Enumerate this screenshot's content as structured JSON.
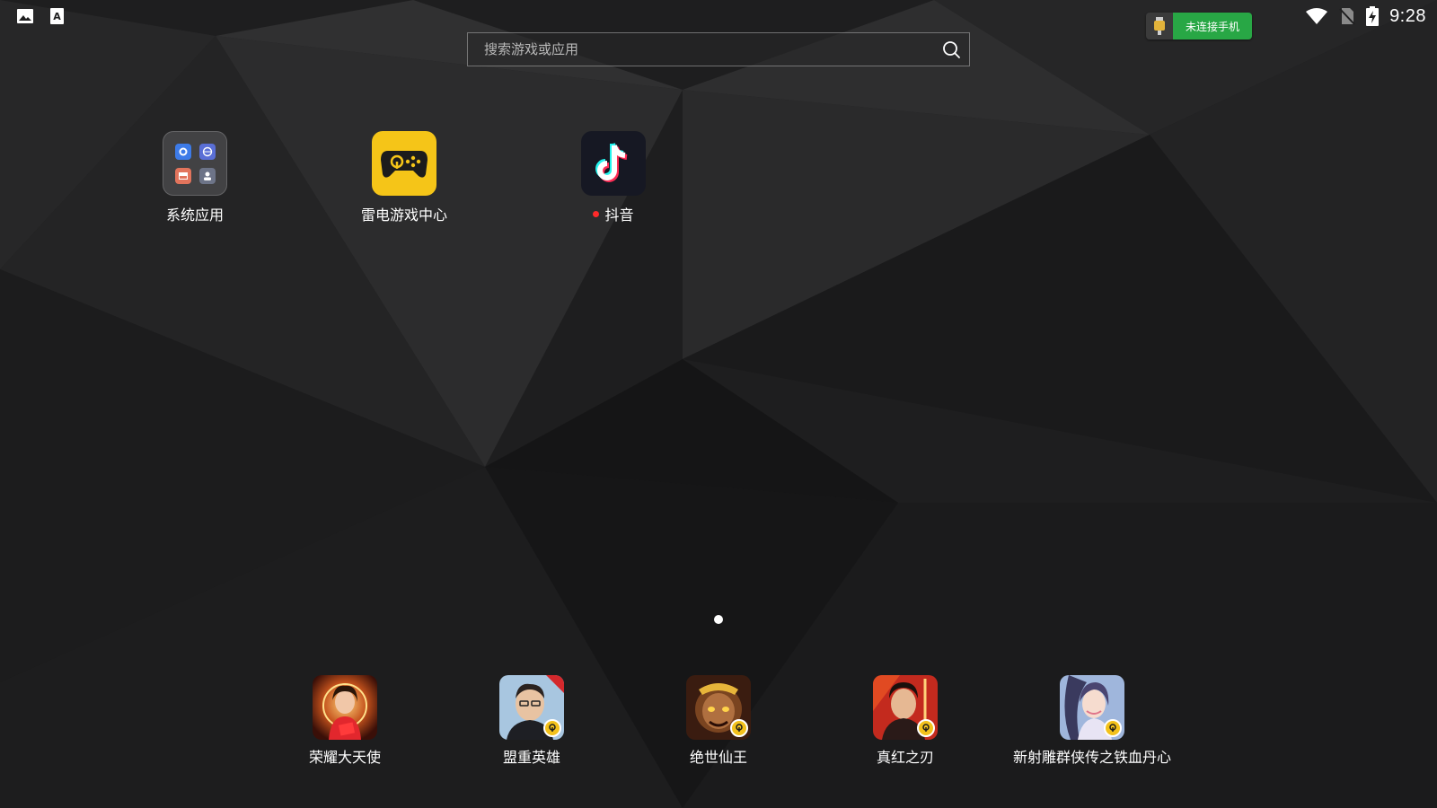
{
  "status_bar": {
    "left_icons": [
      "image-icon",
      "keyboard-a-icon"
    ],
    "phone_button_label": "未连接手机",
    "right_icons": [
      "wifi-icon",
      "no-sim-icon",
      "battery-charging-icon"
    ],
    "time": "9:28"
  },
  "search": {
    "placeholder": "搜索游戏或应用",
    "icon": "search-icon"
  },
  "apps": [
    {
      "label": "系统应用",
      "icon": "system-apps-folder-icon"
    },
    {
      "label": "雷电游戏中心",
      "icon": "ldplayer-game-center-icon"
    },
    {
      "label": "抖音",
      "icon": "douyin-icon",
      "new_badge": true
    }
  ],
  "page_indicator": {
    "pages": 1,
    "current": 1
  },
  "dock": [
    {
      "label": "荣耀大天使",
      "icon": "rongyao-datianshi-icon"
    },
    {
      "label": "盟重英雄",
      "icon": "mengzhong-yingxiong-icon"
    },
    {
      "label": "绝世仙王",
      "icon": "jueshi-xianwang-icon"
    },
    {
      "label": "真红之刃",
      "icon": "zhenhong-zhiren-icon"
    },
    {
      "label": "新射雕群侠传之铁血丹心",
      "icon": "xin-shediao-icon"
    }
  ],
  "colors": {
    "wallpaper": "#1f1f20",
    "phone_button": "#28a745",
    "game_center": "#f5c518",
    "douyin_bg": "#161823",
    "new_dot": "#ff2a2a"
  }
}
